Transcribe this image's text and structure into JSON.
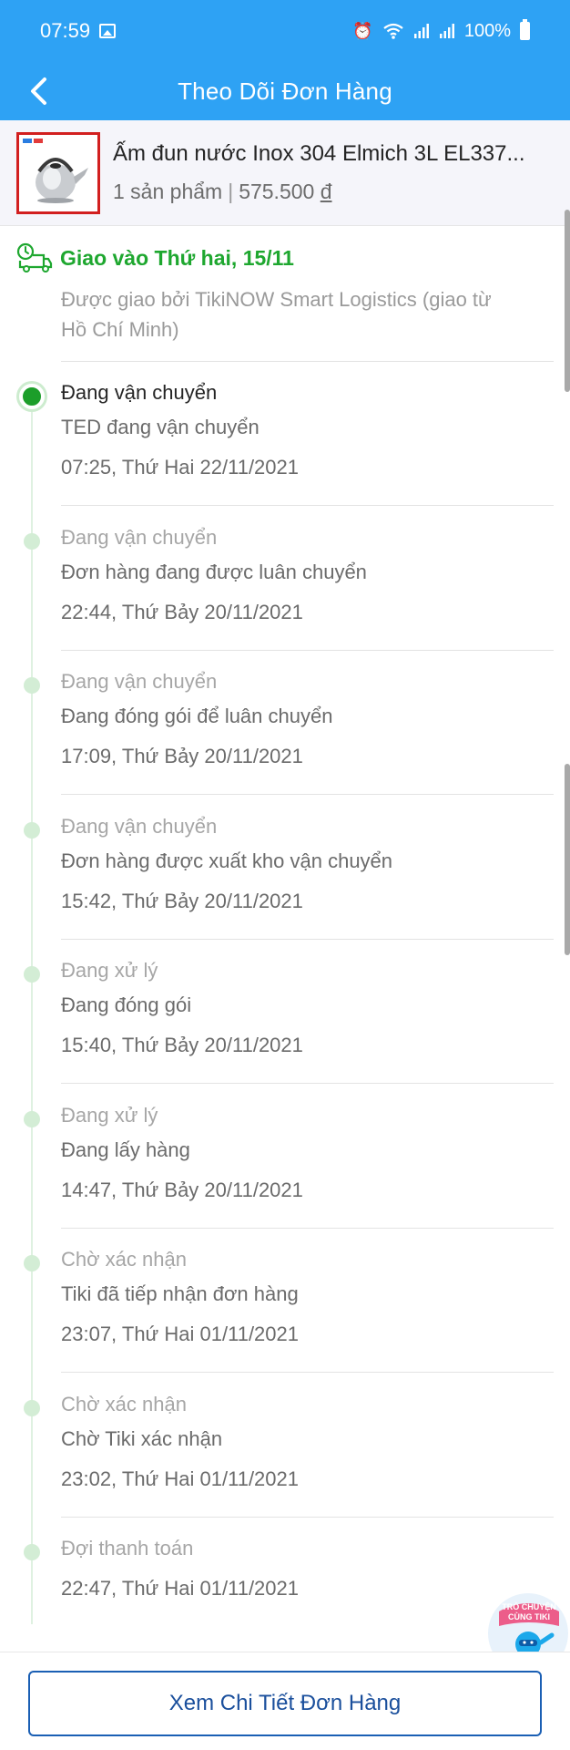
{
  "status_bar": {
    "time": "07:59",
    "battery": "100%",
    "icons": [
      "image-icon",
      "alarm-icon",
      "wifi-icon",
      "signal-icon",
      "signal-icon",
      "battery-icon"
    ]
  },
  "header": {
    "title": "Theo Dõi Đơn Hàng",
    "back_icon": "chevron-left-icon"
  },
  "product": {
    "name": "Ấm đun nước Inox 304 Elmich 3L EL337...",
    "count": "1 sản phẩm",
    "price": "575.500",
    "currency": "đ"
  },
  "delivery": {
    "icon": "truck-clock-icon",
    "date": "Giao vào Thứ hai, 15/11",
    "carrier_line1": "Được giao bởi TikiNOW Smart Logistics (giao từ",
    "carrier_line2": "Hồ Chí Minh)"
  },
  "timeline": [
    {
      "status": "Đang vận chuyển",
      "desc": "TED đang vận chuyển",
      "time": "07:25, Thứ Hai 22/11/2021",
      "active": true
    },
    {
      "status": "Đang vận chuyển",
      "desc": "Đơn hàng đang được luân chuyển",
      "time": "22:44, Thứ Bảy 20/11/2021",
      "active": false
    },
    {
      "status": "Đang vận chuyển",
      "desc": "Đang đóng gói để luân chuyển",
      "time": "17:09, Thứ Bảy 20/11/2021",
      "active": false
    },
    {
      "status": "Đang vận chuyển",
      "desc": "Đơn hàng được xuất kho vận chuyển",
      "time": "15:42, Thứ Bảy 20/11/2021",
      "active": false
    },
    {
      "status": "Đang xử lý",
      "desc": "Đang đóng gói",
      "time": "15:40, Thứ Bảy 20/11/2021",
      "active": false
    },
    {
      "status": "Đang xử lý",
      "desc": "Đang lấy hàng",
      "time": "14:47, Thứ Bảy 20/11/2021",
      "active": false
    },
    {
      "status": "Chờ xác nhận",
      "desc": "Tiki đã tiếp nhận đơn hàng",
      "time": "23:07, Thứ Hai 01/11/2021",
      "active": false
    },
    {
      "status": "Chờ xác nhận",
      "desc": "Chờ Tiki xác nhận",
      "time": "23:02, Thứ Hai 01/11/2021",
      "active": false
    },
    {
      "status": "Đợi thanh toán",
      "desc": "",
      "time": "22:47, Thứ Hai 01/11/2021",
      "active": false
    }
  ],
  "chat": {
    "line1": "TRÒ CHUYỆN",
    "line2": "CÙNG TIKI"
  },
  "bottom": {
    "detail_button": "Xem Chi Tiết Đơn Hàng"
  },
  "colors": {
    "header_blue": "#2ea2f4",
    "delivery_green": "#1ea72f",
    "active_dot": "#1c9e2a",
    "inactive_dot": "#d3edd5",
    "button_blue": "#1a5fb4",
    "thumb_border": "#d21f1f"
  }
}
